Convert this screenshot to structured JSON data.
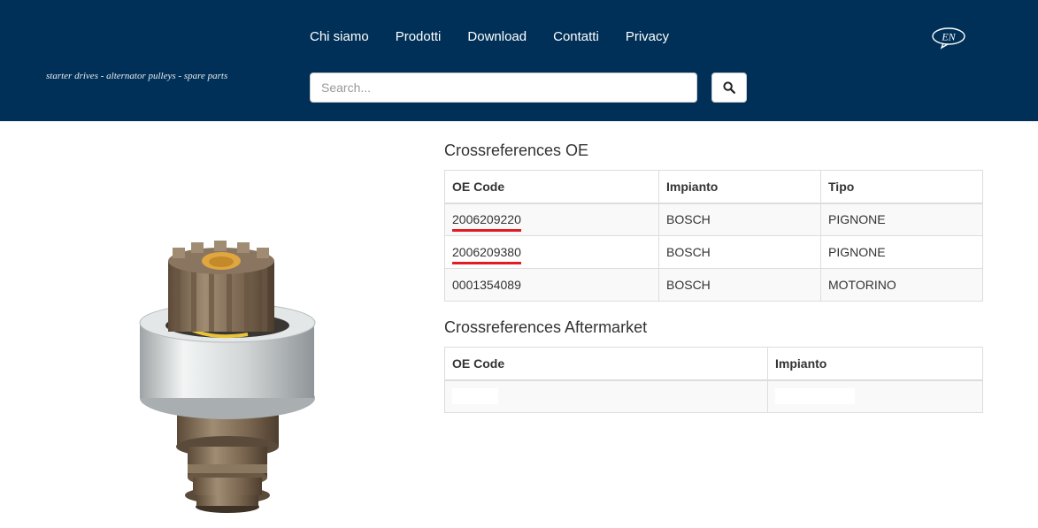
{
  "header": {
    "tagline": "starter drives - alternator pulleys - spare parts",
    "nav": [
      "Chi siamo",
      "Prodotti",
      "Download",
      "Contatti",
      "Privacy"
    ],
    "lang": "EN",
    "search_placeholder": "Search...",
    "search_icon": "search-icon"
  },
  "oe_section": {
    "title": "Crossreferences OE",
    "headers": [
      "OE Code",
      "Impianto",
      "Tipo"
    ],
    "rows": [
      {
        "code": "2006209220",
        "impianto": "BOSCH",
        "tipo": "PIGNONE"
      },
      {
        "code": "2006209380",
        "impianto": "BOSCH",
        "tipo": "PIGNONE"
      },
      {
        "code": "0001354089",
        "impianto": "BOSCH",
        "tipo": "MOTORINO"
      }
    ]
  },
  "aftermarket_section": {
    "title": "Crossreferences Aftermarket",
    "headers": [
      "OE Code",
      "Impianto"
    ]
  },
  "colors": {
    "header_bg": "#003057",
    "underline": "#e01c24"
  }
}
